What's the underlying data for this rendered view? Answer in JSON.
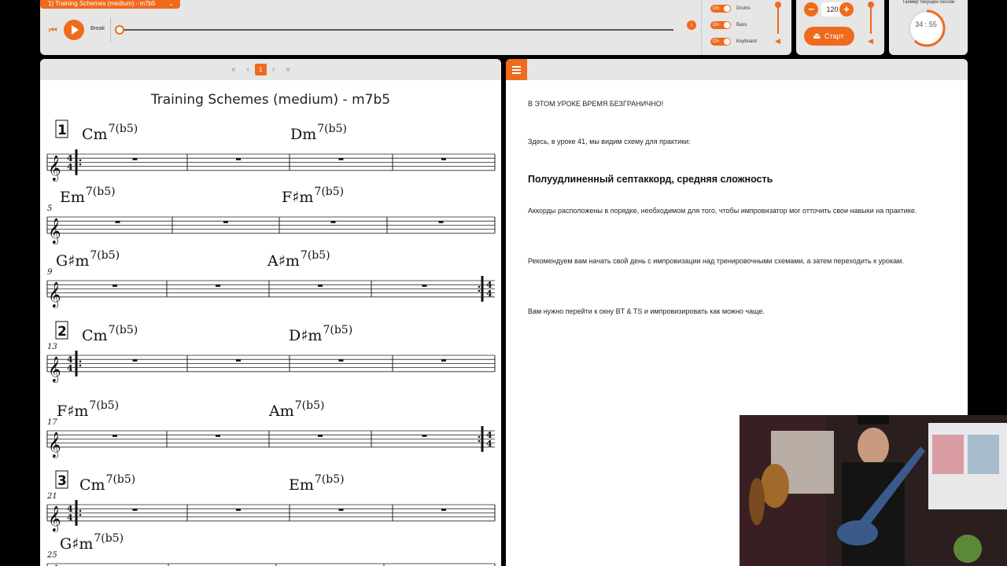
{
  "player": {
    "track_title": "1) Training Schemes (medium) - m7b5",
    "break_label": "Break",
    "instruments": [
      {
        "toggle": "On",
        "label": "Drums"
      },
      {
        "toggle": "On",
        "label": "Bass"
      },
      {
        "toggle": "On",
        "label": "Keyboard"
      }
    ]
  },
  "tempo": {
    "minus": "−",
    "value": "120",
    "plus": "+",
    "start_label": "Старт"
  },
  "timer": {
    "label": "Таймер текущей сессии",
    "value": "34 : 55",
    "progress": 0.62
  },
  "score": {
    "pager": {
      "first": "«",
      "prev": "‹",
      "page": "1",
      "next": "›",
      "last": "»"
    },
    "title": "Training Schemes (medium) - m7b5",
    "rehearsal_marks": [
      "1",
      "2",
      "3"
    ],
    "measure_numbers": [
      "5",
      "9",
      "13",
      "17",
      "21",
      "25"
    ],
    "chords": [
      {
        "root": "Cm",
        "ext": "7(b5)"
      },
      {
        "root": "Dm",
        "ext": "7(b5)"
      },
      {
        "root": "Em",
        "ext": "7(b5)"
      },
      {
        "root": "F♯m",
        "ext": "7(b5)"
      },
      {
        "root": "G♯m",
        "ext": "7(b5)"
      },
      {
        "root": "A♯m",
        "ext": "7(b5)"
      },
      {
        "root": "Cm",
        "ext": "7(b5)"
      },
      {
        "root": "D♯m",
        "ext": "7(b5)"
      },
      {
        "root": "F♯m",
        "ext": "7(b5)"
      },
      {
        "root": "Am",
        "ext": "7(b5)"
      },
      {
        "root": "Cm",
        "ext": "7(b5)"
      },
      {
        "root": "Em",
        "ext": "7(b5)"
      },
      {
        "root": "G♯m",
        "ext": "7(b5)"
      }
    ]
  },
  "lesson": {
    "p1": "В ЭТОМ УРОКЕ ВРЕМЯ БЕЗГРАНИЧНО!",
    "p2": "Здесь, в уроке 41, мы видим схему для практики:",
    "heading": "Полуудлиненный септаккорд, средняя сложность",
    "p3": "Аккорды расположены в порядке, необходимом для того, чтобы импровизатор мог отточить свои навыки на практике.",
    "p4": "Рекомендуем вам начать свой день с импровизации над тренировочными схемами, а затем переходить к урокам.",
    "p5": "Вам нужно перейти к окну BT & TS и импровизировать как можно чаще."
  }
}
